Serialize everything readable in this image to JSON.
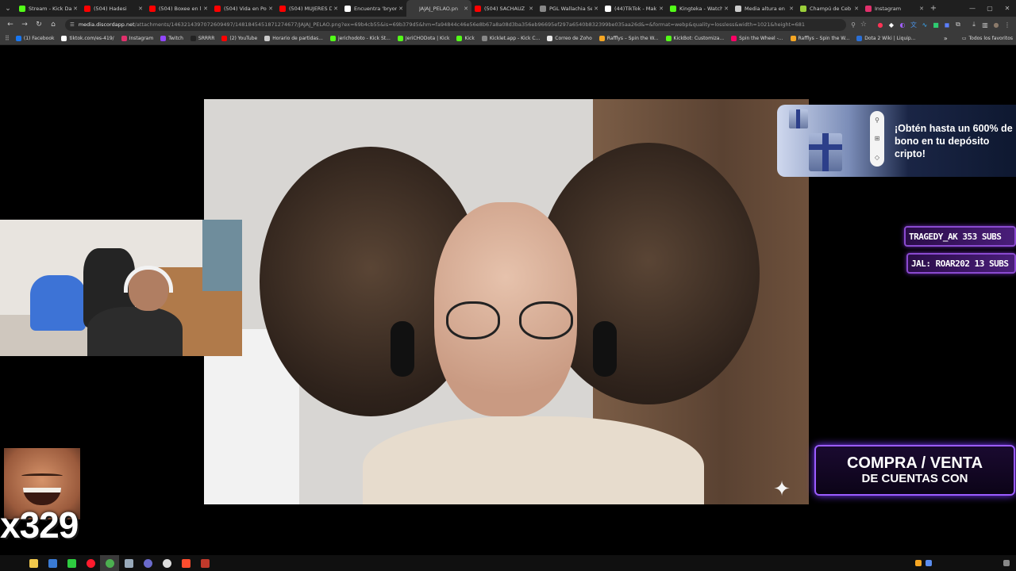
{
  "browser": {
    "tabs": [
      {
        "label": "Stream - Kick Da",
        "color": "#53fc18",
        "active": false
      },
      {
        "label": "(504) Hadesi",
        "color": "#ff0000",
        "active": false
      },
      {
        "label": "(504) Boxee en la",
        "color": "#ff0000",
        "active": false
      },
      {
        "label": "(504) Vida en Pol",
        "color": "#ff0000",
        "active": false
      },
      {
        "label": "(504) MUJERES D",
        "color": "#ff0000",
        "active": false
      },
      {
        "label": "Encuentra 'bryon",
        "color": "#ffffff",
        "active": false
      },
      {
        "label": "JAJAJ_PELAO.pn",
        "color": "#3a3a3a",
        "active": true
      },
      {
        "label": "(504) SACHAUZ",
        "color": "#ff0000",
        "active": false
      },
      {
        "label": "PGL Wallachia Se",
        "color": "#888888",
        "active": false
      },
      {
        "label": "(44)TikTok - Mak",
        "color": "#ffffff",
        "active": false
      },
      {
        "label": "Kingteka - Watch",
        "color": "#53fc18",
        "active": false
      },
      {
        "label": "Media altura en",
        "color": "#cccccc",
        "active": false
      },
      {
        "label": "Champú de Ceb",
        "color": "#9bd03a",
        "active": false
      },
      {
        "label": "Instagram",
        "color": "#e1306c",
        "active": false
      }
    ],
    "url_host": "media.discordapp.net",
    "url_path": "/attachments/1463214397072609497/1481845451871274677/JAJAJ_PELAO.png?ex=69b4cb55&is=69b379d5&hm=fa94844c46e56e8b67a8a08d3ba356eb96695ef297a6540b832399be035aa26d&=&format=webp&quality=lossless&width=1021&height=681",
    "bookmarks": [
      {
        "label": "(1) Facebook",
        "color": "#1877f2"
      },
      {
        "label": "tiktok.com/es-419/",
        "color": "#ffffff"
      },
      {
        "label": "Instagram",
        "color": "#e1306c"
      },
      {
        "label": "Twitch",
        "color": "#9146ff"
      },
      {
        "label": "SRRRR",
        "color": "#222222"
      },
      {
        "label": "(2) YouTube",
        "color": "#ff0000"
      },
      {
        "label": "Horario de partidas...",
        "color": "#cccccc"
      },
      {
        "label": "jerichodoto - Kick St...",
        "color": "#53fc18"
      },
      {
        "label": "JeriCHODota | Kick",
        "color": "#53fc18"
      },
      {
        "label": "Kick",
        "color": "#53fc18"
      },
      {
        "label": "Kicklet.app - Kick C...",
        "color": "#888888"
      },
      {
        "label": "Correo de Zoho",
        "color": "#e8e8e8"
      },
      {
        "label": "Rafflys – Spin the W...",
        "color": "#f5a623"
      },
      {
        "label": "KickBot: Customiza...",
        "color": "#53fc18"
      },
      {
        "label": "Spin the Wheel -...",
        "color": "#f06"
      },
      {
        "label": "Rafflys – Spin the W...",
        "color": "#f5a623"
      },
      {
        "label": "Dota 2 Wiki | Liquip...",
        "color": "#2a6fd6"
      }
    ],
    "bookmarks_all": "Todos los favoritos"
  },
  "overlay": {
    "promo_text": "¡Obtén hasta un 600% de bono en tu depósito cripto!",
    "subs": [
      "TRAGEDY_AK 353 SUBS",
      "JAL: ROAR202 13 SUBS"
    ],
    "banner_line1": "COMPRA / VENTA",
    "banner_line2": "DE CUENTAS CON",
    "combo": "x329"
  },
  "taskbar": {
    "icons": [
      {
        "name": "file-explorer-icon",
        "color": "#f2c94c"
      },
      {
        "name": "shield-icon",
        "color": "#3a7bd5"
      },
      {
        "name": "green-app-icon",
        "color": "#2ecc40"
      },
      {
        "name": "opera-icon",
        "color": "#ff1b2d"
      },
      {
        "name": "chrome-icon",
        "color": "#4caf50"
      },
      {
        "name": "steam-icon",
        "color": "#9ab"
      },
      {
        "name": "obs-icon",
        "color": "#6b6bcc"
      },
      {
        "name": "github-icon",
        "color": "#dddddd"
      },
      {
        "name": "red-app-icon",
        "color": "#ff4d2e"
      },
      {
        "name": "media-app-icon",
        "color": "#c0392b"
      }
    ]
  }
}
